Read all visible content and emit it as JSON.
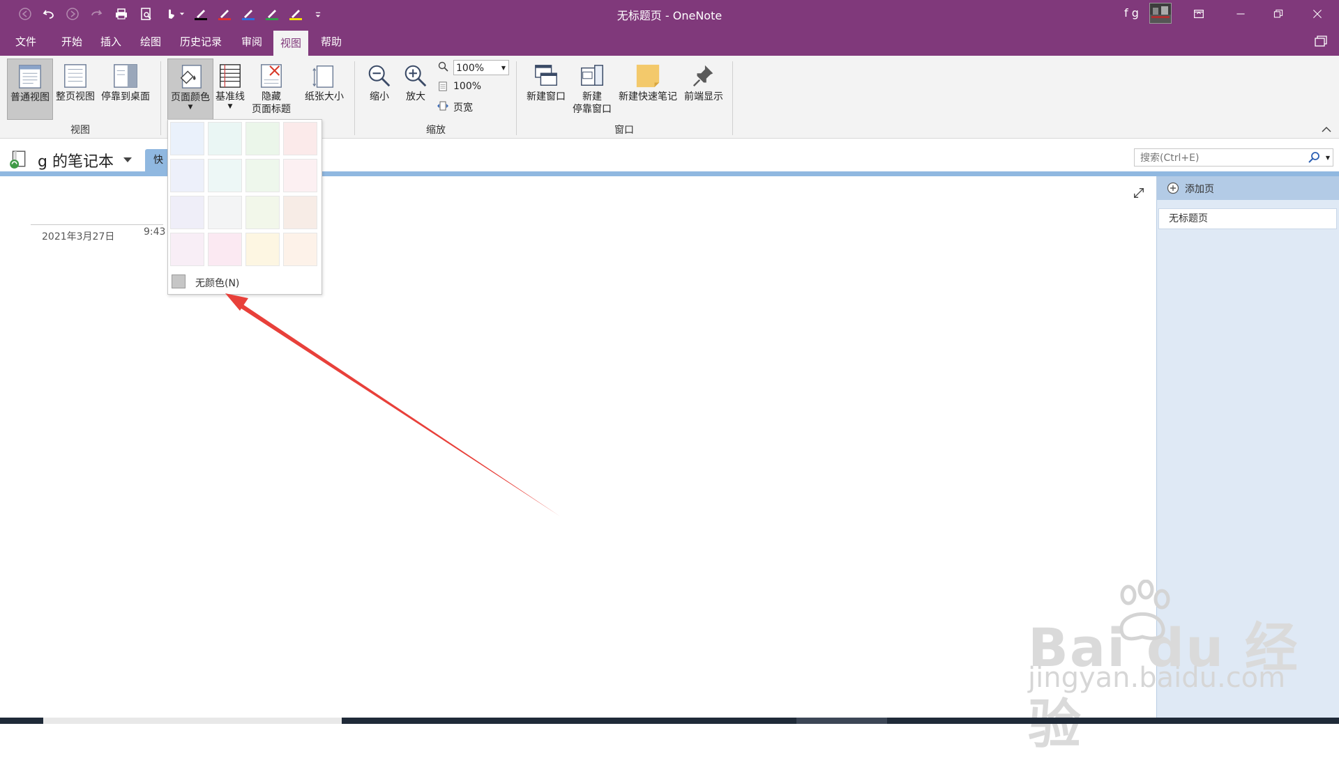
{
  "window": {
    "title": "无标题页  -  OneNote",
    "user": "f g"
  },
  "menu": {
    "items": [
      "文件",
      "开始",
      "插入",
      "绘图",
      "历史记录",
      "审阅",
      "视图",
      "帮助"
    ],
    "active": "视图"
  },
  "ribbon": {
    "view_group": {
      "label": "视图",
      "normal_view": "普通视图",
      "full_page_view": "整页视图",
      "dock_to_desktop": "停靠到桌面"
    },
    "page_setup": {
      "page_color": "页面颜色",
      "rule_lines": "基准线",
      "hide_page_title_1": "隐藏",
      "hide_page_title_2": "页面标题",
      "paper_size": "纸张大小"
    },
    "zoom_group": {
      "label": "缩放",
      "zoom_out": "缩小",
      "zoom_in": "放大",
      "zoom_value": "100%",
      "hundred_percent": "100%",
      "page_width": "页宽"
    },
    "window_group": {
      "label": "窗口",
      "new_window": "新建窗口",
      "new_docked_window_1": "新建",
      "new_docked_window_2": "停靠窗口",
      "new_quick_note": "新建快速笔记",
      "always_on_top": "前端显示"
    }
  },
  "notebook": {
    "name": "g 的笔记本",
    "section_tab": "快"
  },
  "search": {
    "placeholder": "搜索(Ctrl+E)"
  },
  "page": {
    "date": "2021年3月27日",
    "time": "9:43"
  },
  "pages_pane": {
    "add_page": "添加页",
    "pages": [
      "无标题页"
    ]
  },
  "color_popup": {
    "swatches": [
      "#eaf1fb",
      "#eaf6f4",
      "#ebf6ea",
      "#fbeaea",
      "#edf0fa",
      "#edf7f6",
      "#eef7ec",
      "#fcf0f2",
      "#efeef8",
      "#f3f4f5",
      "#f2f7ea",
      "#f7ece6",
      "#f8eef6",
      "#fbe9f2",
      "#fdf6e2",
      "#fdf2e9"
    ],
    "no_color": "无颜色(N)"
  },
  "colors": {
    "titlebar": "#80397b",
    "ribbon": "#f3f3f3",
    "pagepane": "#dfe9f5",
    "arrow": "#e8403a"
  },
  "watermark": {
    "brand": "Bai du 经验",
    "url": "jingyan.baidu.com"
  }
}
